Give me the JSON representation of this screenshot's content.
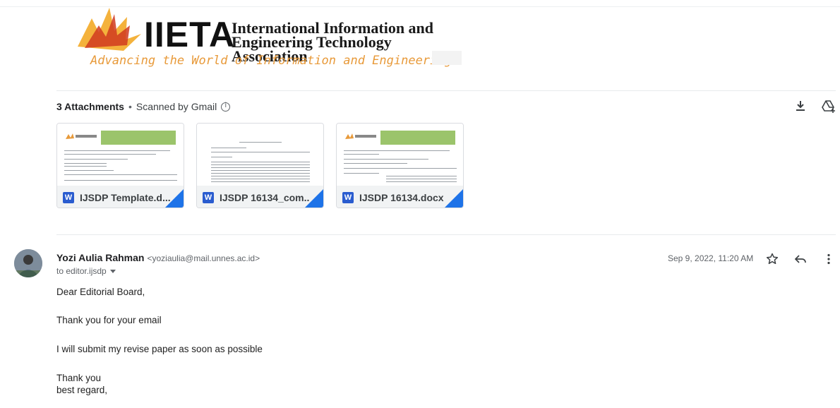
{
  "banner": {
    "logo_text": "IIETA",
    "association_line1": "International Information and",
    "association_line2": "Engineering Technology Association",
    "tagline": "Advancing the World of Information and Engineering"
  },
  "attachments": {
    "count_label": "3 Attachments",
    "separator": "•",
    "scanned_label": "Scanned by Gmail",
    "files": [
      {
        "name": "IJSDP Template.d...",
        "type_letter": "W"
      },
      {
        "name": "IJSDP 16134_com...",
        "type_letter": "W"
      },
      {
        "name": "IJSDP 16134.docx",
        "type_letter": "W"
      }
    ]
  },
  "message": {
    "sender_name": "Yozi Aulia Rahman",
    "sender_email": "<yoziaulia@mail.unnes.ac.id>",
    "to": "to editor.ijsdp",
    "date": "Sep 9, 2022, 11:20 AM",
    "body": {
      "greeting": "Dear Editorial Board,",
      "line1": "Thank you for your email",
      "line2": "I will submit my revise paper as soon as possible",
      "closing1": "Thank you",
      "closing2": "best regard,"
    }
  },
  "colors": {
    "word_blue": "#2a5ccf",
    "fold_blue": "#1e73e8",
    "tagline_orange": "#e89a3a",
    "logo_red": "#d0391f"
  }
}
